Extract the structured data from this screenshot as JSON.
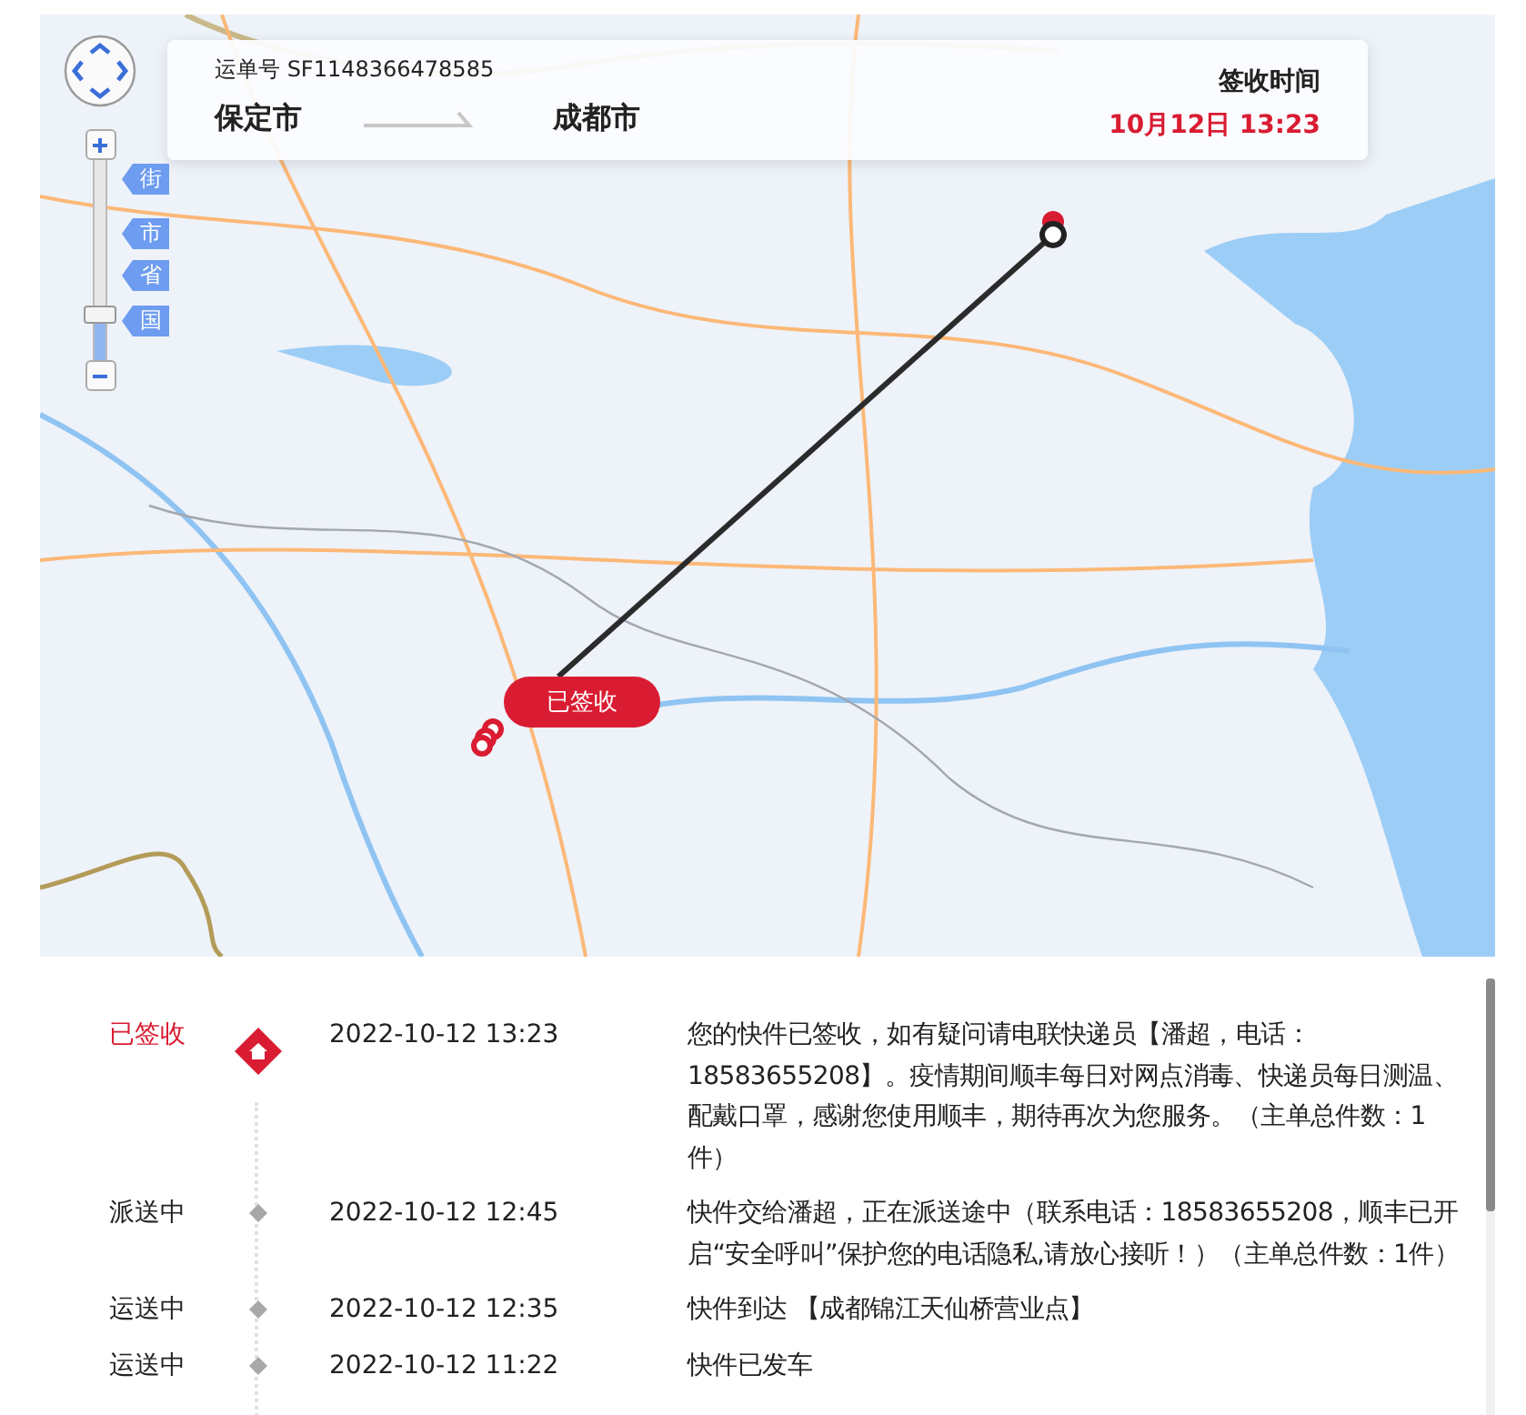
{
  "map": {
    "kind": "picture",
    "zoom_levels": [
      {
        "label": "街"
      },
      {
        "label": "市"
      },
      {
        "label": "省"
      },
      {
        "label": "国"
      }
    ],
    "zoom_slider": {
      "level": 0.2
    },
    "route_badge": "已签收"
  },
  "summary": {
    "waybill_label": "运单号",
    "waybill_no": "SF1148366478585",
    "origin": "保定市",
    "destination": "成都市",
    "time_label": "签收时间",
    "time": "10月12日 13:23"
  },
  "timeline": [
    {
      "status": "已签收",
      "current": true,
      "time": "2022-10-12 13:23",
      "description": "您的快件已签收，如有疑问请电联快递员【潘超，电话：18583655208】。疫情期间顺丰每日对网点消毒、快递员每日测温、配戴口罩，感谢您使用顺丰，期待再次为您服务。（主单总件数：1件）"
    },
    {
      "status": "派送中",
      "current": false,
      "time": "2022-10-12 12:45",
      "description": "快件交给潘超，正在派送途中（联系电话：18583655208，顺丰已开启“安全呼叫”保护您的电话隐私,请放心接听！）（主单总件数：1件）"
    },
    {
      "status": "运送中",
      "current": false,
      "time": "2022-10-12 12:35",
      "description": "快件到达 【成都锦江天仙桥营业点】"
    },
    {
      "status": "运送中",
      "current": false,
      "time": "2022-10-12 11:22",
      "description": "快件已发车"
    }
  ]
}
